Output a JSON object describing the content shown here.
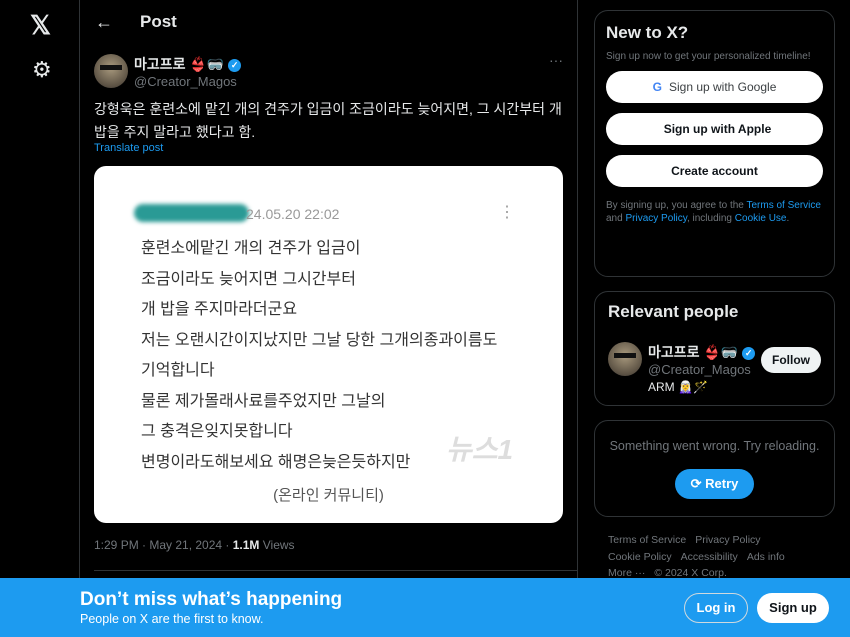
{
  "nav": {
    "logo": "𝕏",
    "settings_icon": "⚙"
  },
  "header": {
    "back_icon": "←",
    "title": "Post"
  },
  "post": {
    "display_name": "마고프로",
    "emoji": "👙🥽",
    "handle": "@Creator_Magos",
    "more": "···",
    "text": "강형욱은 훈련소에 맡긴 개의 견주가 입금이 조금이라도 늦어지면, 그 시간부터 개밥을 주지 말라고 했다고 함.",
    "translate": "Translate post",
    "image": {
      "date": "24.05.20 22:02",
      "lines": [
        "훈련소에맡긴 개의 견주가 입금이",
        "조금이라도 늦어지면 그시간부터",
        "개 밥을 주지마라더군요",
        "저는 오랜시간이지났지만 그날 당한 그개의종과이름도",
        "기억합니다",
        "물론 제가몰래사료를주었지만 그날의",
        "그 충격은잊지못합니다",
        "변명이라도해보세요 해명은늦은듯하지만"
      ],
      "source": "(온라인 커뮤니티)",
      "watermark": "뉴스1"
    },
    "time": "1:29 PM · May 21, 2024 · ",
    "views_count": "1.1M",
    "views_label": " Views"
  },
  "signup": {
    "title": "New to X?",
    "subtitle": "Sign up now to get your personalized timeline!",
    "google": "Sign up with Google",
    "apple": "Sign up with Apple",
    "create": "Create account",
    "terms_pre": "By signing up, you agree to the ",
    "terms_link": "Terms of Service",
    "and": " and ",
    "privacy_link": "Privacy Policy",
    "including": ", including ",
    "cookie_link": "Cookie Use",
    "end": "."
  },
  "relevant": {
    "title": "Relevant people",
    "name": "마고프로",
    "emoji": "👙🥽",
    "handle": "@Creator_Magos",
    "bio": "ARM 🧝‍♀️🪄",
    "follow": "Follow"
  },
  "error": {
    "message": "Something went wrong. Try reloading.",
    "retry": "Retry"
  },
  "footer": {
    "links": [
      "Terms of Service",
      "Privacy Policy",
      "Cookie Policy",
      "Accessibility",
      "Ads info",
      "More ···",
      "© 2024 X Corp."
    ]
  },
  "banner": {
    "title": "Don’t miss what’s happening",
    "subtitle": "People on X are the first to know.",
    "login": "Log in",
    "signup": "Sign up"
  },
  "colors": {
    "accent": "#1d9bf0",
    "background": "#000000"
  }
}
